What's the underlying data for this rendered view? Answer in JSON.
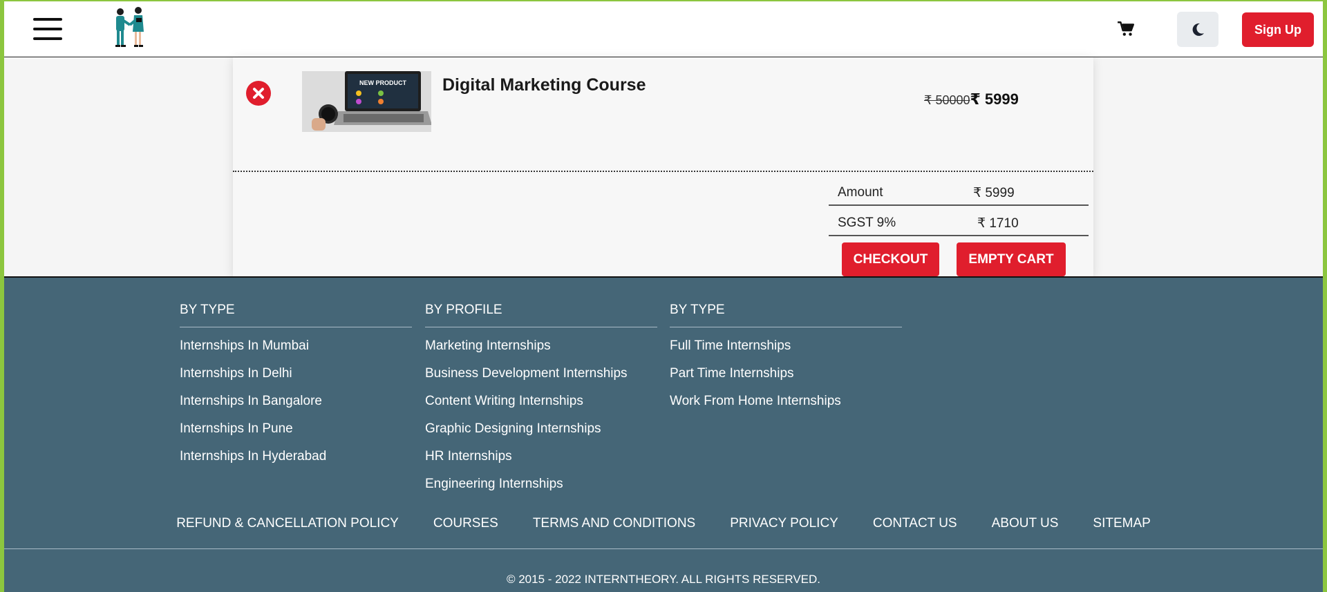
{
  "header": {
    "signup_label": "Sign Up"
  },
  "cart": {
    "item": {
      "title": "Digital Marketing Course",
      "old_price": "₹ 50000",
      "new_price": "₹ 5999",
      "thumbnail_text": "NEW PRODUCT"
    },
    "summary": [
      {
        "label": "Amount",
        "value": "₹ 5999"
      },
      {
        "label": "SGST 9%",
        "value": "₹ 1710"
      }
    ],
    "checkout_label": "CHECKOUT",
    "empty_label": "EMPTY CART"
  },
  "footer": {
    "columns": [
      {
        "heading": "BY TYPE",
        "links": [
          "Internships In Mumbai",
          "Internships In Delhi",
          "Internships In Bangalore",
          "Internships In Pune",
          "Internships In Hyderabad"
        ]
      },
      {
        "heading": "BY PROFILE",
        "links": [
          "Marketing Internships",
          "Business Development Internships",
          "Content Writing Internships",
          "Graphic Designing Internships",
          "HR Internships",
          "Engineering Internships"
        ]
      },
      {
        "heading": "BY TYPE",
        "links": [
          "Full Time Internships",
          "Part Time Internships",
          "Work From Home Internships"
        ]
      }
    ],
    "bottom_links": [
      "REFUND & CANCELLATION POLICY",
      "COURSES",
      "TERMS AND CONDITIONS",
      "PRIVACY POLICY",
      "CONTACT US",
      "ABOUT US",
      "SITEMAP"
    ],
    "copyright": "© 2015 - 2022 INTERNTHEORY. ALL RIGHTS RESERVED."
  },
  "colors": {
    "accent_red": "#e01e2d",
    "footer_bg": "#456677",
    "page_border": "#8cc63f"
  },
  "icons": [
    "menu-icon",
    "handshake-logo",
    "cart-icon",
    "moon-icon",
    "close-circle-icon"
  ]
}
